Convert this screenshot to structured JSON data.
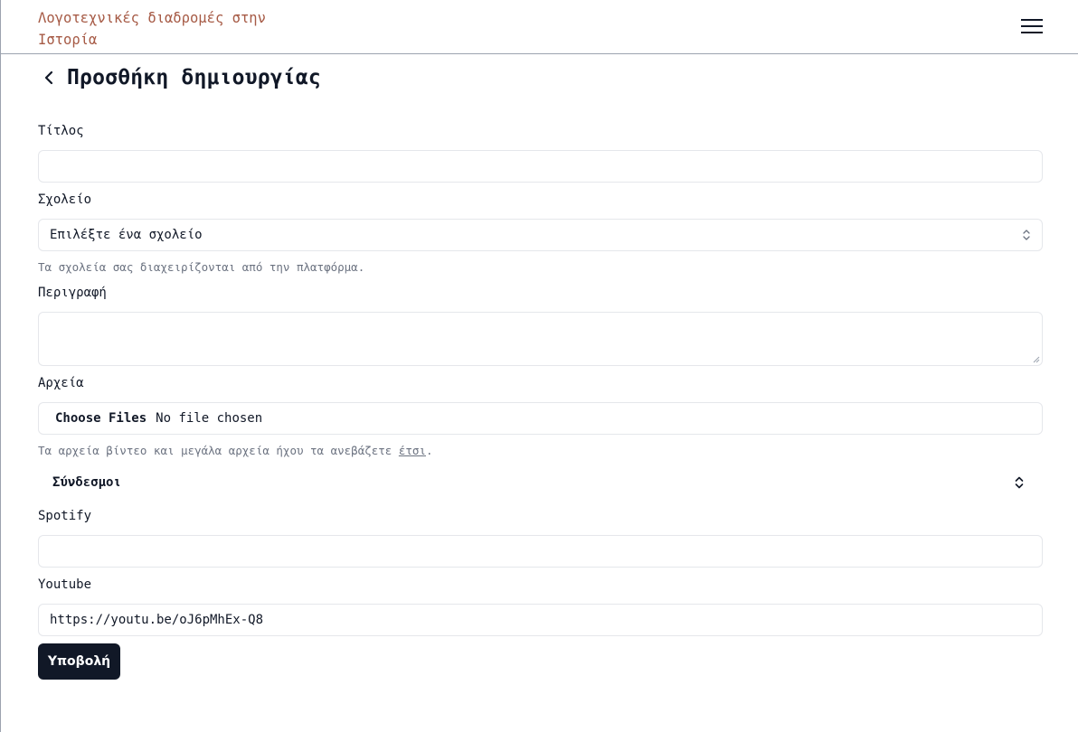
{
  "header": {
    "site_title": "Λογοτεχνικές διαδρομές στην Ιστορία"
  },
  "page": {
    "title": "Προσθήκη δημιουργίας"
  },
  "form": {
    "title": {
      "label": "Τίτλος",
      "value": ""
    },
    "school": {
      "label": "Σχολείο",
      "selected": "Επιλέξτε ένα σχολείο",
      "help": "Τα σχολεία σας διαχειρίζονται από την πλατφόρμα."
    },
    "description": {
      "label": "Περιγραφή",
      "value": ""
    },
    "files": {
      "label": "Αρχεία",
      "button": "Choose Files",
      "status": "No file chosen",
      "help_prefix": "Τα αρχεία βίντεο και μεγάλα αρχεία ήχου τα ανεβάζετε ",
      "help_link": "έτσι",
      "help_suffix": "."
    },
    "links": {
      "label": "Σύνδεσμοι",
      "spotify": {
        "label": "Spotify",
        "value": ""
      },
      "youtube": {
        "label": "Youtube",
        "value": "https://youtu.be/oJ6pMhEx-Q8"
      }
    },
    "submit_label": "Υποβολή"
  },
  "icons": {
    "menu": "hamburger-menu-icon",
    "back": "chevron-left-icon",
    "select": "chevron-up-down-icon",
    "accordion": "chevron-up-down-icon",
    "resize": "resize-grip-icon"
  }
}
